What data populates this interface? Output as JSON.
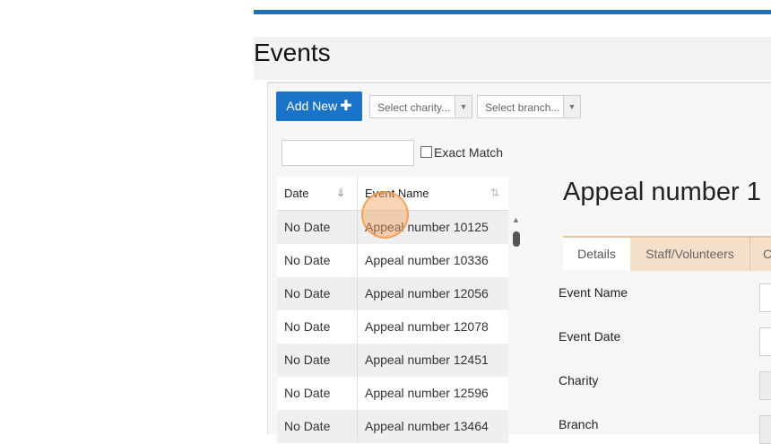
{
  "page": {
    "title": "Events"
  },
  "toolbar": {
    "add_new_label": "Add New",
    "charity_select": "Select charity...",
    "branch_select": "Select branch..."
  },
  "filter": {
    "search_value": "",
    "exact_match_label": "Exact Match"
  },
  "table": {
    "columns": [
      "Date",
      "Event Name"
    ],
    "rows": [
      {
        "date": "No Date",
        "name": "Appeal number 10125"
      },
      {
        "date": "No Date",
        "name": "Appeal number 10336"
      },
      {
        "date": "No Date",
        "name": "Appeal number 12056"
      },
      {
        "date": "No Date",
        "name": "Appeal number 12078"
      },
      {
        "date": "No Date",
        "name": "Appeal number 12451"
      },
      {
        "date": "No Date",
        "name": "Appeal number 12596"
      },
      {
        "date": "No Date",
        "name": "Appeal number 13464"
      }
    ]
  },
  "detail": {
    "title": "Appeal number 1",
    "tabs": [
      "Details",
      "Staff/Volunteers",
      "C"
    ],
    "fields": [
      "Event Name",
      "Event Date",
      "Charity",
      "Branch"
    ]
  },
  "colors": {
    "accent": "#1a73c8",
    "tab_inactive": "#f6dfc8",
    "row_stripe": "#efefef"
  }
}
